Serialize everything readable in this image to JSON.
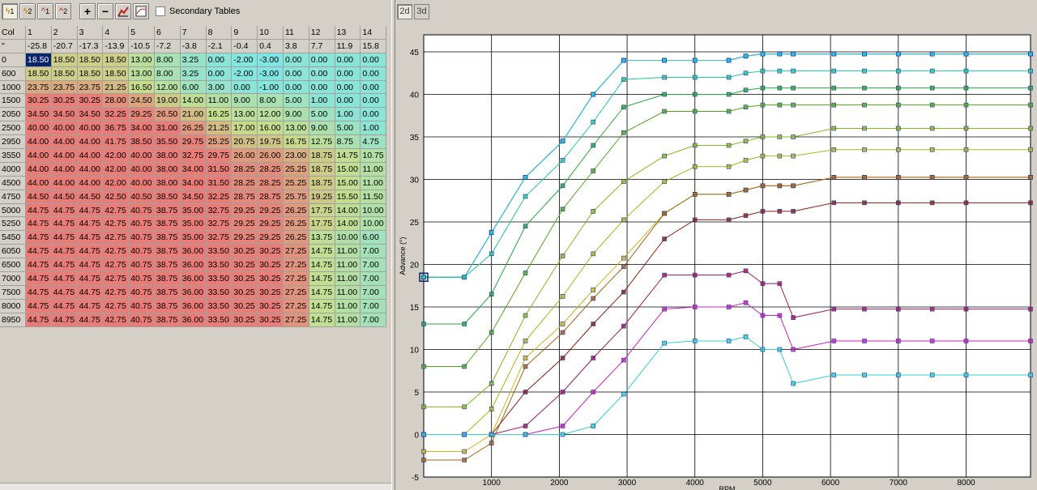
{
  "toolbar": {
    "buttons": [
      {
        "name": "table1-button",
        "label": "1",
        "icon": "lightning-icon"
      },
      {
        "name": "table2-button",
        "label": "2",
        "icon": "lightning-icon"
      },
      {
        "name": "chart1-button",
        "label": "1",
        "icon": "flame-icon"
      },
      {
        "name": "chart2-button",
        "label": "2",
        "icon": "flame-icon"
      },
      {
        "name": "add-button",
        "label": "+",
        "icon": "plus-icon"
      },
      {
        "name": "remove-button",
        "label": "−",
        "icon": "minus-icon"
      },
      {
        "name": "chart-tool-button",
        "label": "",
        "icon": "graph-icon"
      },
      {
        "name": "curve-button",
        "label": "",
        "icon": "curve-icon"
      }
    ],
    "secondary_tables_label": "Secondary Tables"
  },
  "view_tabs": {
    "tab_2d": "2d",
    "tab_3d": "3d"
  },
  "grid": {
    "corner": "Col",
    "corner2": "\"",
    "columns": [
      "1",
      "2",
      "3",
      "4",
      "5",
      "6",
      "7",
      "8",
      "9",
      "10",
      "11",
      "12",
      "13",
      "14"
    ],
    "col_values": [
      "-25.8",
      "-20.7",
      "-17.3",
      "-13.9",
      "-10.5",
      "-7.2",
      "-3.8",
      "-2.1",
      "-0.4",
      "0.4",
      "3.8",
      "7.7",
      "11.9",
      "15.8"
    ],
    "rows": [
      {
        "label": "0",
        "values": [
          "18.50",
          "18.50",
          "18.50",
          "18.50",
          "13.00",
          "8.00",
          "3.25",
          "0.00",
          "-2.00",
          "-3.00",
          "0.00",
          "0.00",
          "0.00",
          "0.00"
        ]
      },
      {
        "label": "600",
        "values": [
          "18.50",
          "18.50",
          "18.50",
          "18.50",
          "13.00",
          "8.00",
          "3.25",
          "0.00",
          "-2.00",
          "-3.00",
          "0.00",
          "0.00",
          "0.00",
          "0.00"
        ]
      },
      {
        "label": "1000",
        "values": [
          "23.75",
          "23.75",
          "23.75",
          "21.25",
          "16.50",
          "12.00",
          "6.00",
          "3.00",
          "0.00",
          "-1.00",
          "0.00",
          "0.00",
          "0.00",
          "0.00"
        ]
      },
      {
        "label": "1500",
        "values": [
          "30.25",
          "30.25",
          "30.25",
          "28.00",
          "24.50",
          "19.00",
          "14.00",
          "11.00",
          "9.00",
          "8.00",
          "5.00",
          "1.00",
          "0.00",
          "0.00"
        ]
      },
      {
        "label": "2050",
        "values": [
          "34.50",
          "34.50",
          "34.50",
          "32.25",
          "29.25",
          "26.50",
          "21.00",
          "16.25",
          "13.00",
          "12.00",
          "9.00",
          "5.00",
          "1.00",
          "0.00"
        ]
      },
      {
        "label": "2500",
        "values": [
          "40.00",
          "40.00",
          "40.00",
          "36.75",
          "34.00",
          "31.00",
          "26.25",
          "21.25",
          "17.00",
          "16.00",
          "13.00",
          "9.00",
          "5.00",
          "1.00"
        ]
      },
      {
        "label": "2950",
        "values": [
          "44.00",
          "44.00",
          "44.00",
          "41.75",
          "38.50",
          "35.50",
          "29.75",
          "25.25",
          "20.75",
          "19.75",
          "16.75",
          "12.75",
          "8.75",
          "4.75"
        ]
      },
      {
        "label": "3550",
        "values": [
          "44.00",
          "44.00",
          "44.00",
          "42.00",
          "40.00",
          "38.00",
          "32.75",
          "29.75",
          "26.00",
          "26.00",
          "23.00",
          "18.75",
          "14.75",
          "10.75"
        ]
      },
      {
        "label": "4000",
        "values": [
          "44.00",
          "44.00",
          "44.00",
          "42.00",
          "40.00",
          "38.00",
          "34.00",
          "31.50",
          "28.25",
          "28.25",
          "25.25",
          "18.75",
          "15.00",
          "11.00"
        ]
      },
      {
        "label": "4500",
        "values": [
          "44.00",
          "44.00",
          "44.00",
          "42.00",
          "40.00",
          "38.00",
          "34.00",
          "31.50",
          "28.25",
          "28.25",
          "25.25",
          "18.75",
          "15.00",
          "11.00"
        ]
      },
      {
        "label": "4750",
        "values": [
          "44.50",
          "44.50",
          "44.50",
          "42.50",
          "40.50",
          "38.50",
          "34.50",
          "32.25",
          "28.75",
          "28.75",
          "25.75",
          "19.25",
          "15.50",
          "11.50"
        ]
      },
      {
        "label": "5000",
        "values": [
          "44.75",
          "44.75",
          "44.75",
          "42.75",
          "40.75",
          "38.75",
          "35.00",
          "32.75",
          "29.25",
          "29.25",
          "26.25",
          "17.75",
          "14.00",
          "10.00"
        ]
      },
      {
        "label": "5250",
        "values": [
          "44.75",
          "44.75",
          "44.75",
          "42.75",
          "40.75",
          "38.75",
          "35.00",
          "32.75",
          "29.25",
          "29.25",
          "26.25",
          "17.75",
          "14.00",
          "10.00"
        ]
      },
      {
        "label": "5450",
        "values": [
          "44.75",
          "44.75",
          "44.75",
          "42.75",
          "40.75",
          "38.75",
          "35.00",
          "32.75",
          "29.25",
          "29.25",
          "26.25",
          "13.75",
          "10.00",
          "6.00"
        ]
      },
      {
        "label": "6050",
        "values": [
          "44.75",
          "44.75",
          "44.75",
          "42.75",
          "40.75",
          "38.75",
          "36.00",
          "33.50",
          "30.25",
          "30.25",
          "27.25",
          "14.75",
          "11.00",
          "7.00"
        ]
      },
      {
        "label": "6500",
        "values": [
          "44.75",
          "44.75",
          "44.75",
          "42.75",
          "40.75",
          "38.75",
          "36.00",
          "33.50",
          "30.25",
          "30.25",
          "27.25",
          "14.75",
          "11.00",
          "7.00"
        ]
      },
      {
        "label": "7000",
        "values": [
          "44.75",
          "44.75",
          "44.75",
          "42.75",
          "40.75",
          "38.75",
          "36.00",
          "33.50",
          "30.25",
          "30.25",
          "27.25",
          "14.75",
          "11.00",
          "7.00"
        ]
      },
      {
        "label": "7500",
        "values": [
          "44.75",
          "44.75",
          "44.75",
          "42.75",
          "40.75",
          "38.75",
          "36.00",
          "33.50",
          "30.25",
          "30.25",
          "27.25",
          "14.75",
          "11.00",
          "7.00"
        ]
      },
      {
        "label": "8000",
        "values": [
          "44.75",
          "44.75",
          "44.75",
          "42.75",
          "40.75",
          "38.75",
          "36.00",
          "33.50",
          "30.25",
          "30.25",
          "27.25",
          "14.75",
          "11.00",
          "7.00"
        ]
      },
      {
        "label": "8950",
        "values": [
          "44.75",
          "44.75",
          "44.75",
          "42.75",
          "40.75",
          "38.75",
          "36.00",
          "33.50",
          "30.25",
          "30.25",
          "27.25",
          "14.75",
          "11.00",
          "7.00"
        ]
      }
    ],
    "color_scale": {
      "low": "#7fe6e6",
      "mid": "#c6dd8c",
      "high": "#ea7c78"
    }
  },
  "chart_data": {
    "type": "line",
    "ylabel": "Advance (°)",
    "xlabel": "RPM",
    "x": [
      0,
      600,
      1000,
      1500,
      2050,
      2500,
      2950,
      3550,
      4000,
      4500,
      4750,
      5000,
      5250,
      5450,
      6050,
      6500,
      7000,
      7500,
      8000,
      8950
    ],
    "xticks": [
      "1000",
      "2000",
      "3000",
      "4000",
      "5000",
      "6000",
      "7000",
      "8000"
    ],
    "yticks": [
      "-5",
      "0",
      "5",
      "10",
      "15",
      "20",
      "25",
      "30",
      "35",
      "40",
      "45"
    ],
    "xlim": [
      0,
      8950
    ],
    "ylim": [
      -5,
      47
    ],
    "series_colors": [
      "#1a3aa0",
      "#2a80c8",
      "#30c8d8",
      "#20c8a0",
      "#20a838",
      "#50a818",
      "#88b818",
      "#a8b818",
      "#c8b818",
      "#a86010",
      "#8a2010",
      "#a01858",
      "#c820b8",
      "#30d0d0"
    ]
  }
}
